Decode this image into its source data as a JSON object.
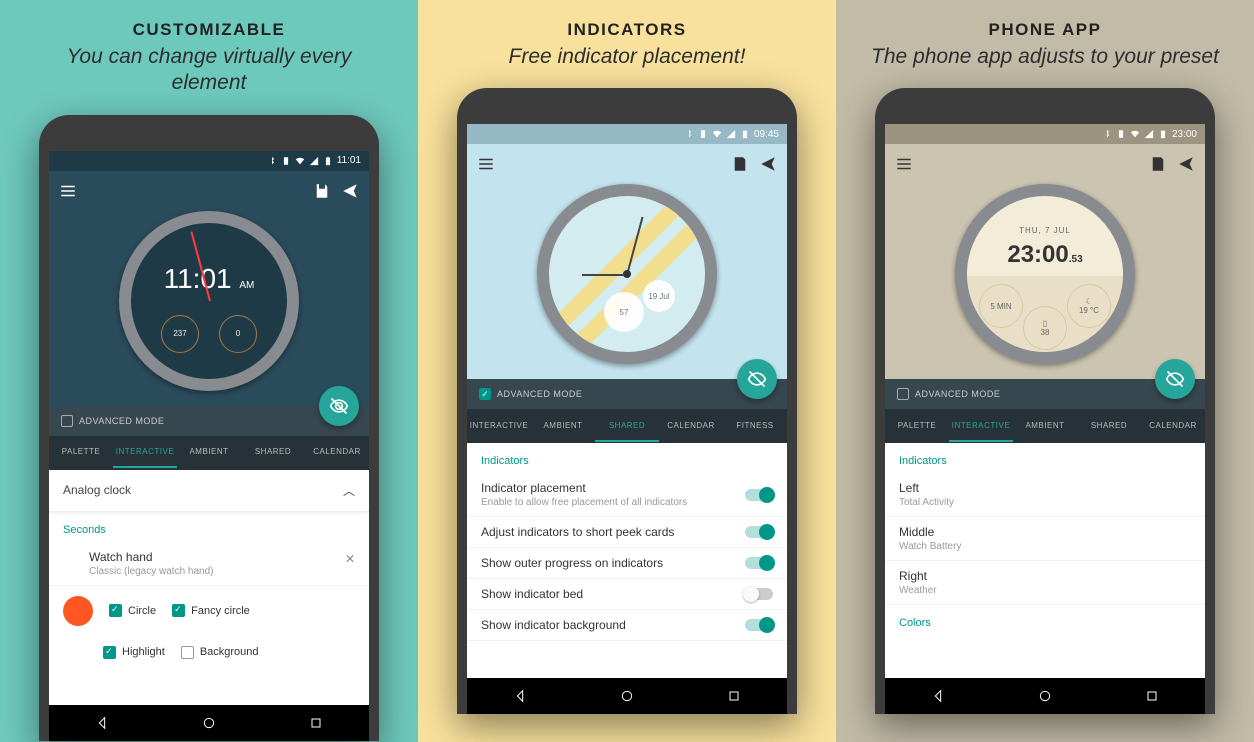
{
  "panels": [
    {
      "title": "CUSTOMIZABLE",
      "subtitle": "You can change virtually every element"
    },
    {
      "title": "INDICATORS",
      "subtitle": "Free indicator placement!"
    },
    {
      "title": "PHONE APP",
      "subtitle": "The phone app adjusts to your preset"
    }
  ],
  "phone1": {
    "time": "11:01",
    "adv_label": "ADVANCED MODE",
    "tabs": [
      "PALETTE",
      "INTERACTIVE",
      "AMBIENT",
      "SHARED",
      "CALENDAR"
    ],
    "active_tab": 1,
    "panel_header": "Analog clock",
    "section": "Seconds",
    "watch_hand_title": "Watch hand",
    "watch_hand_sub": "Classic (legacy watch hand)",
    "chk_circle": "Circle",
    "chk_fancy": "Fancy circle",
    "chk_highlight": "Highlight",
    "chk_background": "Background",
    "face_time": "11:01",
    "face_am": "AM",
    "dial_left": "237",
    "dial_right": "0"
  },
  "phone2": {
    "time": "09:45",
    "adv_label": "ADVANCED MODE",
    "tabs": [
      "INTERACTIVE",
      "AMBIENT",
      "SHARED",
      "CALENDAR",
      "FITNESS"
    ],
    "active_tab": 2,
    "section": "Indicators",
    "items": [
      {
        "title": "Indicator placement",
        "sub": "Enable to allow free placement of all indicators",
        "on": true
      },
      {
        "title": "Adjust indicators to short peek cards",
        "on": true
      },
      {
        "title": "Show outer progress on indicators",
        "on": true
      },
      {
        "title": "Show indicator bed",
        "on": false
      },
      {
        "title": "Show indicator background",
        "on": true
      }
    ],
    "bubble_val": "57",
    "bubble_date": "19 Jul"
  },
  "phone3": {
    "time": "23:00",
    "adv_label": "ADVANCED MODE",
    "tabs": [
      "PALETTE",
      "INTERACTIVE",
      "AMBIENT",
      "SHARED",
      "CALENDAR"
    ],
    "active_tab": 1,
    "section": "Indicators",
    "items": [
      {
        "title": "Left",
        "sub": "Total Activity"
      },
      {
        "title": "Middle",
        "sub": "Watch Battery"
      },
      {
        "title": "Right",
        "sub": "Weather"
      }
    ],
    "section2": "Colors",
    "face_date": "THU, 7 JUL",
    "face_time": "23:00",
    "face_sec": "53",
    "dial_left": "5 MIN",
    "dial_mid": "38",
    "dial_right": "19 °C"
  }
}
